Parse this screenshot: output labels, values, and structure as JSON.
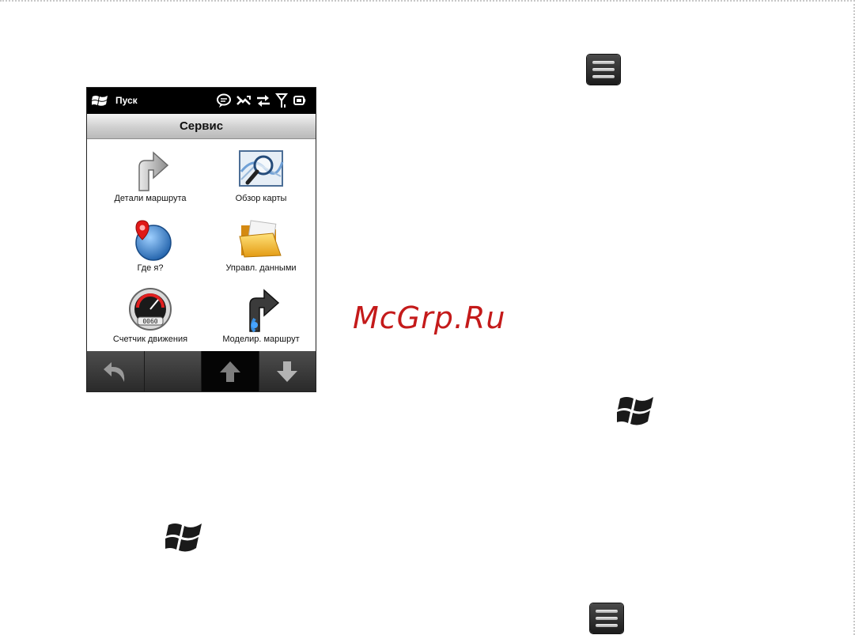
{
  "phone": {
    "status": {
      "start_label": "Пуск"
    },
    "title": "Сервис",
    "tiles": [
      {
        "label": "Детали маршрута",
        "icon": "turn-arrow-icon"
      },
      {
        "label": "Обзор карты",
        "icon": "map-magnifier-icon"
      },
      {
        "label": "Где я?",
        "icon": "location-globe-icon"
      },
      {
        "label": "Управл. данными",
        "icon": "folder-icon"
      },
      {
        "label": "Счетчик движения",
        "icon": "speedometer-icon"
      },
      {
        "label": "Моделир. маршрут",
        "icon": "route-simulation-icon"
      }
    ],
    "bottom_buttons": [
      "back-icon",
      "blank",
      "arrow-up-icon",
      "arrow-down-icon"
    ]
  },
  "watermark": "McGrp.Ru",
  "colors": {
    "watermark": "#c41a1a",
    "statusbar": "#000000",
    "accent_blue": "#2d6fb8"
  }
}
